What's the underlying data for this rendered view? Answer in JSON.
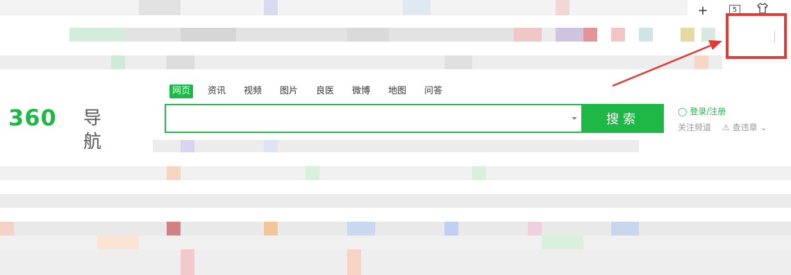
{
  "browser": {
    "new_tab_label": "+",
    "tab_count": "5",
    "shirt_icon": "shirt-icon",
    "apps_icon": "grid-icon"
  },
  "search": {
    "tabs": [
      "网页",
      "资讯",
      "视频",
      "图片",
      "良医",
      "微博",
      "地图",
      "问答"
    ],
    "active_tab": "网页",
    "logo_number": "360",
    "logo_text": "导航",
    "input_value": "",
    "button_label": "搜索"
  },
  "links": {
    "login": "登录/注册",
    "follow": "关注频道",
    "violation": "查违章"
  },
  "colors": {
    "brand_green": "#1db846",
    "annotation_red": "#e53935"
  }
}
